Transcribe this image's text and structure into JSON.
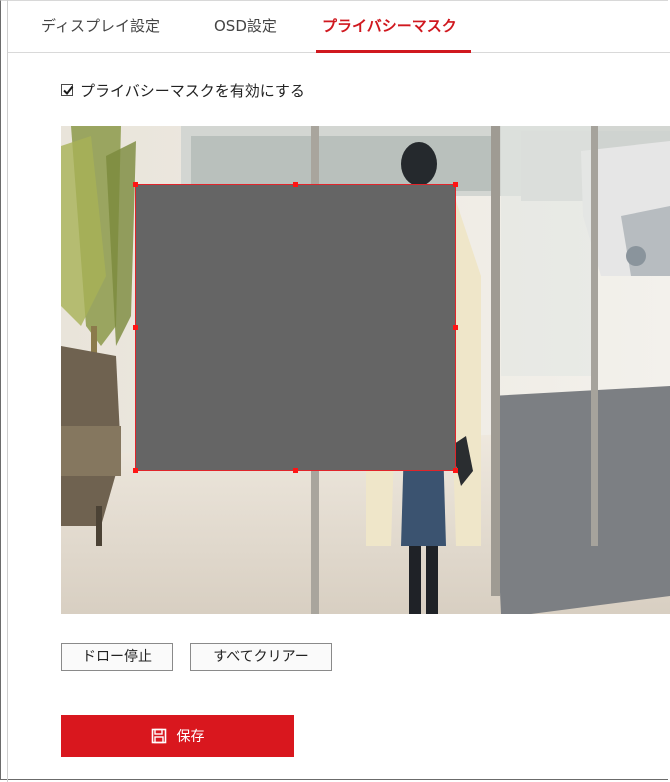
{
  "tabs": [
    {
      "label": "ディスプレイ設定",
      "active": false
    },
    {
      "label": "OSD設定",
      "active": false
    },
    {
      "label": "プライバシーマスク",
      "active": true
    }
  ],
  "privacy_mask": {
    "enable_label": "プライバシーマスクを有効にする",
    "enabled": true
  },
  "buttons": {
    "stop_drawing": "ドロー停止",
    "clear_all": "すべてクリアー",
    "save": "保存"
  },
  "colors": {
    "accent": "#d9171e",
    "mask_fill": "#656565",
    "mask_border": "#e0252b"
  },
  "icons": {
    "save": "save-icon",
    "checkbox": "checkmark-icon"
  }
}
